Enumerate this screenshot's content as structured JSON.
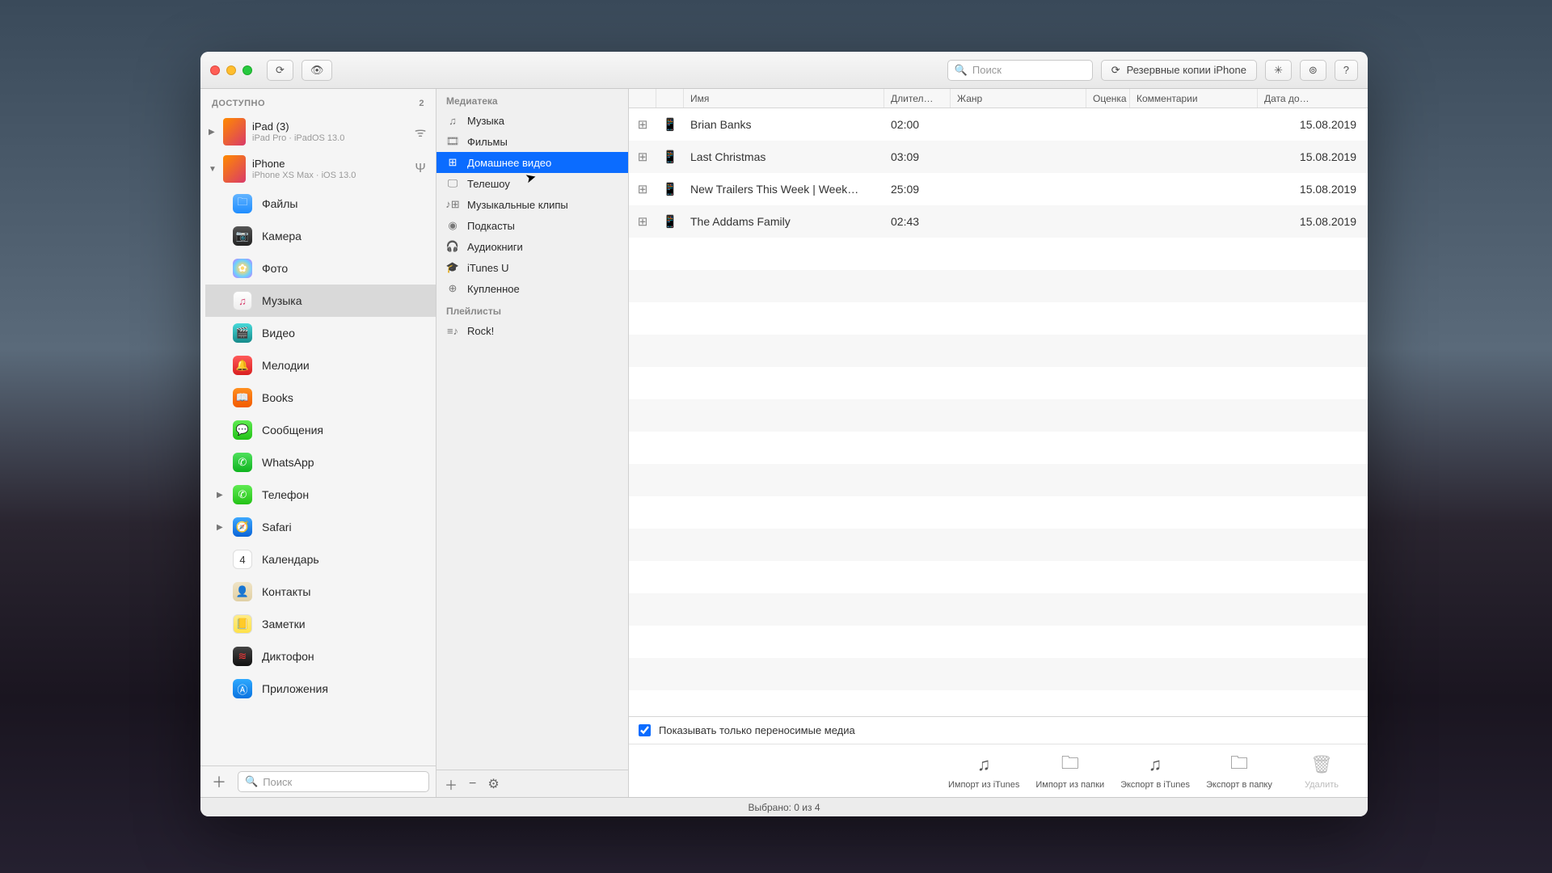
{
  "toolbar": {
    "search_placeholder": "Поиск",
    "backup_label": "Резервные копии iPhone"
  },
  "sidebar": {
    "header": "ДОСТУПНО",
    "count": "2",
    "devices": [
      {
        "title": "iPad (3)",
        "sub": "iPad Pro · iPadOS 13.0"
      },
      {
        "title": "iPhone",
        "sub": "iPhone XS Max · iOS 13.0"
      }
    ],
    "items": [
      {
        "label": "Файлы"
      },
      {
        "label": "Камера"
      },
      {
        "label": "Фото"
      },
      {
        "label": "Музыка"
      },
      {
        "label": "Видео"
      },
      {
        "label": "Мелодии"
      },
      {
        "label": "Books"
      },
      {
        "label": "Сообщения"
      },
      {
        "label": "WhatsApp"
      },
      {
        "label": "Телефон"
      },
      {
        "label": "Safari"
      },
      {
        "label": "Календарь"
      },
      {
        "label": "Контакты"
      },
      {
        "label": "Заметки"
      },
      {
        "label": "Диктофон"
      },
      {
        "label": "Приложения"
      }
    ],
    "calendar_day": "4",
    "bottom_search_placeholder": "Поиск"
  },
  "middle": {
    "library_header": "Медиатека",
    "items": [
      {
        "label": "Музыка"
      },
      {
        "label": "Фильмы"
      },
      {
        "label": "Домашнее видео"
      },
      {
        "label": "Телешоу"
      },
      {
        "label": "Музыкальные клипы"
      },
      {
        "label": "Подкасты"
      },
      {
        "label": "Аудиокниги"
      },
      {
        "label": "iTunes U"
      },
      {
        "label": "Купленное"
      }
    ],
    "playlists_header": "Плейлисты",
    "playlists": [
      {
        "label": "Rock!"
      }
    ]
  },
  "table": {
    "headers": {
      "name": "Имя",
      "duration": "Длител…",
      "genre": "Жанр",
      "rating": "Оценка",
      "comments": "Комментарии",
      "date": "Дата до…"
    },
    "rows": [
      {
        "name": "Brian Banks",
        "duration": "02:00",
        "date": "15.08.2019"
      },
      {
        "name": "Last Christmas",
        "duration": "03:09",
        "date": "15.08.2019"
      },
      {
        "name": "New Trailers This Week | Week…",
        "duration": "25:09",
        "date": "15.08.2019"
      },
      {
        "name": "The Addams Family",
        "duration": "02:43",
        "date": "15.08.2019"
      }
    ]
  },
  "bottom": {
    "checkbox_label": "Показывать только переносимые медиа",
    "actions": {
      "import_itunes": "Импорт из iTunes",
      "import_folder": "Импорт из папки",
      "export_itunes": "Экспорт в iTunes",
      "export_folder": "Экспорт в папку",
      "delete": "Удалить"
    }
  },
  "status": "Выбрано: 0 из 4"
}
